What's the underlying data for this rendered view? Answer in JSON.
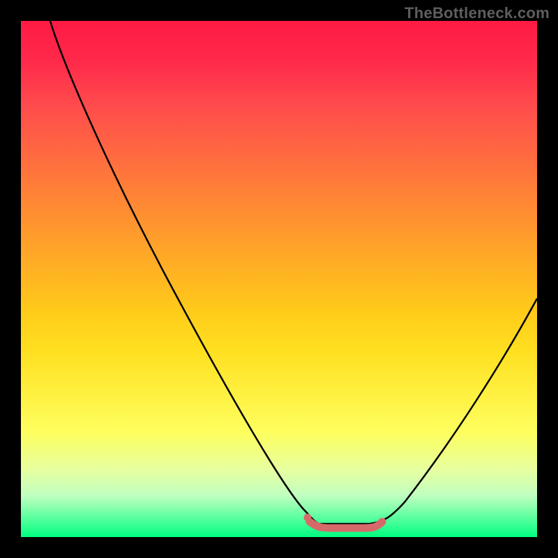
{
  "watermark": "TheBottleneck.com",
  "chart_data": {
    "type": "line",
    "title": "",
    "xlabel": "",
    "ylabel": "",
    "x": [
      0.0,
      0.05,
      0.1,
      0.15,
      0.2,
      0.25,
      0.3,
      0.35,
      0.4,
      0.45,
      0.5,
      0.55,
      0.6,
      0.63,
      0.7,
      0.75,
      0.8,
      0.85,
      0.9,
      0.95,
      1.0
    ],
    "series": [
      {
        "name": "bottleneck-curve",
        "color": "#000000",
        "values": [
          1.0,
          0.92,
          0.84,
          0.76,
          0.68,
          0.6,
          0.52,
          0.44,
          0.36,
          0.28,
          0.2,
          0.12,
          0.05,
          0.0,
          0.0,
          0.02,
          0.08,
          0.17,
          0.27,
          0.38,
          0.5
        ]
      }
    ],
    "highlight_segment": {
      "name": "optimal-zone",
      "color": "#d66a6a",
      "x_range": [
        0.55,
        0.7
      ],
      "y": 0.0
    },
    "highlight_dot": {
      "name": "optimal-point",
      "color": "#d66a6a",
      "x": 0.55,
      "y": 0.01
    },
    "xlim": [
      0,
      1
    ],
    "ylim": [
      0,
      1
    ],
    "grid": false,
    "legend": "none",
    "background": "vertical-gradient red→orange→yellow→green"
  }
}
